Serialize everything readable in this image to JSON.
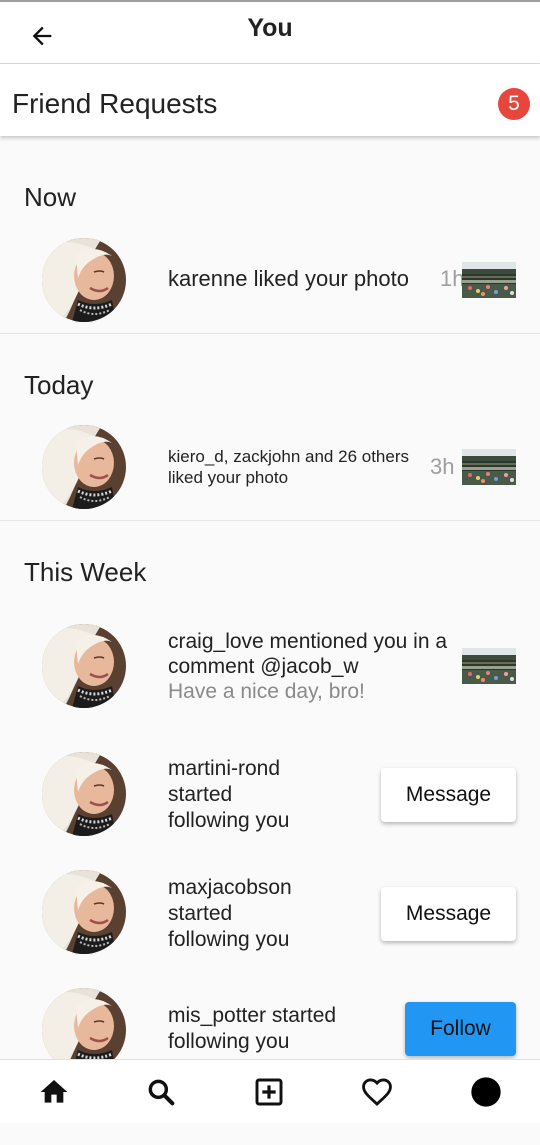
{
  "header": {
    "title": "You"
  },
  "friend_requests": {
    "label": "Friend Requests",
    "count": "5",
    "badge_color": "#e8453c"
  },
  "sections": {
    "now": "Now",
    "today": "Today",
    "this_week": "This Week"
  },
  "items": [
    {
      "text": "karenne liked your photo",
      "time": "1h"
    },
    {
      "text_line1": "kiero_d, zackjohn and 26 others",
      "text_line2": "liked your photo",
      "time": "3h"
    },
    {
      "text_line1": "craig_love mentioned you in a",
      "text_line2": "comment @jacob_w",
      "subtext": "Have a nice day, bro!"
    },
    {
      "line1": "martini-rond",
      "line2": "started",
      "line3": "following you",
      "button": "Message"
    },
    {
      "line1": "maxjacobson",
      "line2": "started",
      "line3": "following you",
      "button": "Message"
    },
    {
      "line1": "mis_potter started",
      "line2": "following you",
      "button": "Follow"
    }
  ],
  "bottom_nav": {
    "icons": [
      "home-icon",
      "search-icon",
      "add-post-icon",
      "heart-icon",
      "profile-icon"
    ]
  },
  "colors": {
    "follow_button": "#2196f3",
    "accent": "#2196f3"
  }
}
